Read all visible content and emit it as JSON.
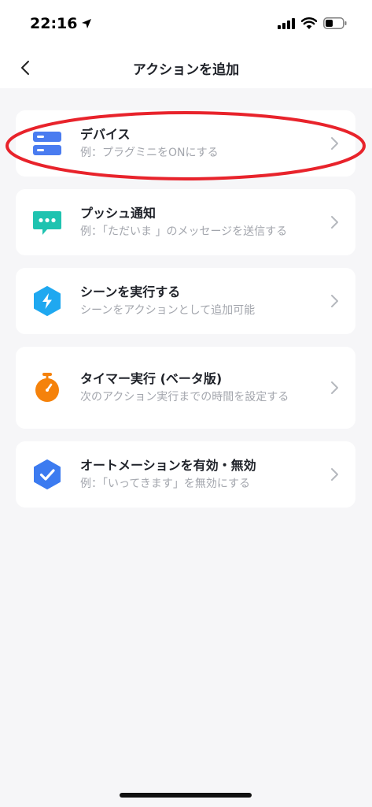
{
  "status_bar": {
    "time": "22:16"
  },
  "nav": {
    "title": "アクションを追加"
  },
  "actions": [
    {
      "title": "デバイス",
      "subtitle": "例：プラグミニをONにする",
      "icon": "device-list-icon",
      "color": "#4a7cf0"
    },
    {
      "title": "プッシュ通知",
      "subtitle": "例：「ただいま 」のメッセージを送信する",
      "icon": "chat-bubble-icon",
      "color": "#1fc3b0"
    },
    {
      "title": "シーンを実行する",
      "subtitle": "シーンをアクションとして追加可能",
      "icon": "lightning-hexagon-icon",
      "color": "#1fa8f0"
    },
    {
      "title": "タイマー実行 (ベータ版)",
      "subtitle": "次のアクション実行までの時間を設定する",
      "icon": "stopwatch-icon",
      "color": "#f5820b"
    },
    {
      "title": "オートメーションを有効・無効",
      "subtitle": "例：「いってきます」を無効にする",
      "icon": "check-hexagon-icon",
      "color": "#3c7bf0"
    }
  ],
  "colors": {
    "background": "#f6f6f8",
    "card": "#ffffff",
    "highlight": "#e8232b"
  }
}
